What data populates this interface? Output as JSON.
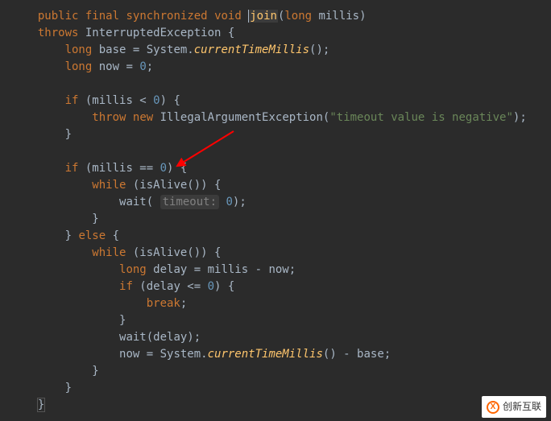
{
  "code": {
    "l1_public": "public",
    "l1_final": "final",
    "l1_synchronized": "synchronized",
    "l1_void": "void",
    "l1_join": "join",
    "l1_long": "long",
    "l1_millis": "millis",
    "l2_throws": "throws",
    "l2_exc": "InterruptedException",
    "l2_brace": "{",
    "l3_long": "long",
    "l3_base": "base = System.",
    "l3_ctm": "currentTimeMillis",
    "l3_end": "();",
    "l4_long": "long",
    "l4_now": "now = ",
    "l4_zero": "0",
    "l4_semi": ";",
    "l6_if": "if",
    "l6_cond": " (millis < ",
    "l6_zero": "0",
    "l6_brace": ") {",
    "l7_throw": "throw",
    "l7_new": "new",
    "l7_exc": "IllegalArgumentException(",
    "l7_str": "\"timeout value is negative\"",
    "l7_end": ");",
    "l8_brace": "}",
    "l10_if": "if",
    "l10_cond": " (millis == ",
    "l10_zero": "0",
    "l10_brace": ") {",
    "l11_while": "while",
    "l11_cond": " (isAlive()) {",
    "l12_wait": "wait( ",
    "l12_hint": "timeout:",
    "l12_sp": " ",
    "l12_zero": "0",
    "l12_end": ");",
    "l13_brace": "}",
    "l14_brace": "} ",
    "l14_else": "else",
    "l14_brace2": " {",
    "l15_while": "while",
    "l15_cond": " (isAlive()) {",
    "l16_long": "long",
    "l16_rest": " delay = millis - now;",
    "l17_if": "if",
    "l17_cond": " (delay <= ",
    "l17_zero": "0",
    "l17_brace": ") {",
    "l18_break": "break",
    "l18_semi": ";",
    "l19_brace": "}",
    "l20_wait": "wait(delay);",
    "l21_now": "now = System.",
    "l21_ctm": "currentTimeMillis",
    "l21_end": "() - base;",
    "l22_brace": "}",
    "l23_brace": "}",
    "l24_brace": "}"
  },
  "watermark": {
    "text": "创新互联",
    "icon": "X"
  }
}
